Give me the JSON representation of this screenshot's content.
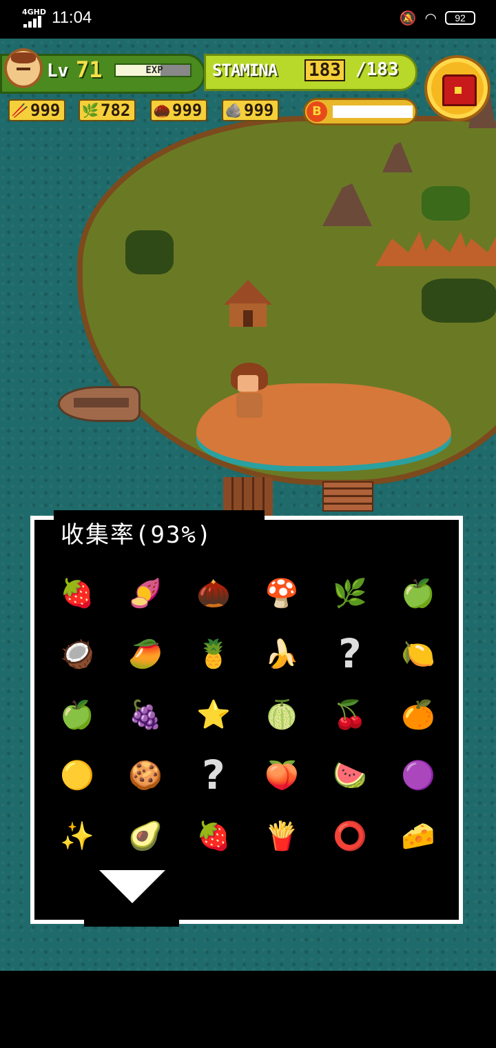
{
  "status_bar": {
    "network": "4GHD",
    "time": "11:04",
    "battery": "92"
  },
  "hud": {
    "level_label": "Lv",
    "level": "71",
    "exp_label": "EXP",
    "exp_fraction": 0.6,
    "stamina_label": "STAMINA",
    "stamina_current": "183",
    "stamina_max": "/183",
    "resources": [
      {
        "icon": "branch-icon",
        "value": "999"
      },
      {
        "icon": "leaf-icon",
        "value": "782"
      },
      {
        "icon": "stone-bag-icon",
        "value": "999"
      },
      {
        "icon": "rock-icon",
        "value": "999"
      }
    ],
    "coin_label": "B"
  },
  "collection": {
    "title": "收集率(93%)",
    "items": [
      "strawberry",
      "sweet-potato",
      "nut",
      "mushroom",
      "herb",
      "lime",
      "coconut",
      "mango",
      "pineapple",
      "banana",
      "unknown",
      "lemon",
      "green-apple",
      "mangosteen",
      "starfruit",
      "durian",
      "berries",
      "orange-mango",
      "pineapple-rings",
      "dried-fruit",
      "unknown",
      "papaya",
      "guava",
      "mangosteen-half",
      "star-slices",
      "durian-pod",
      "pomegranate-seeds",
      "dried-banana",
      "ring-snacks",
      "dried-mango"
    ],
    "unknown_symbol": "?"
  },
  "colors": {
    "sea": "#1f6a6a",
    "grass": "#6a7a24",
    "sand": "#d6783a",
    "hud_green": "#4a8a1e",
    "hud_lime": "#b8d82a"
  }
}
